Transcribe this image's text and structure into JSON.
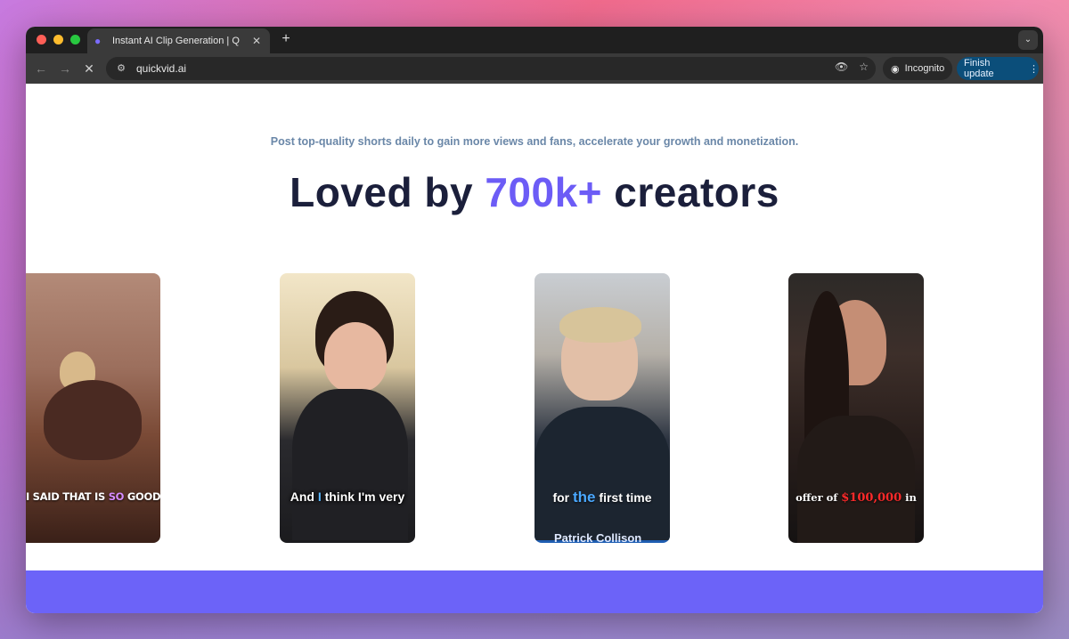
{
  "browser": {
    "tab_title": "Instant AI Clip Generation | Q",
    "url": "quickvid.ai",
    "incognito_label": "Incognito",
    "finish_update_label": "Finish update"
  },
  "page": {
    "tagline": "Post top-quality shorts daily to gain more views and fans, accelerate your growth and monetization.",
    "headline_pre": "Loved by ",
    "headline_accent": "700k+",
    "headline_post": " creators",
    "accent_color": "#6c5cf6",
    "clips": [
      {
        "caption_pre": "I SAID THAT IS ",
        "caption_hl": "SO",
        "caption_post": " GOOD"
      },
      {
        "caption_pre": "And ",
        "caption_hl": "I",
        "caption_post": " think I'm very"
      },
      {
        "caption_pre": "for ",
        "caption_hl": "the",
        "caption_post": " first time",
        "name_strip": "Patrick Collison"
      },
      {
        "caption_pre": "offer of ",
        "caption_hl": "$100,000",
        "caption_post": " in"
      }
    ]
  }
}
